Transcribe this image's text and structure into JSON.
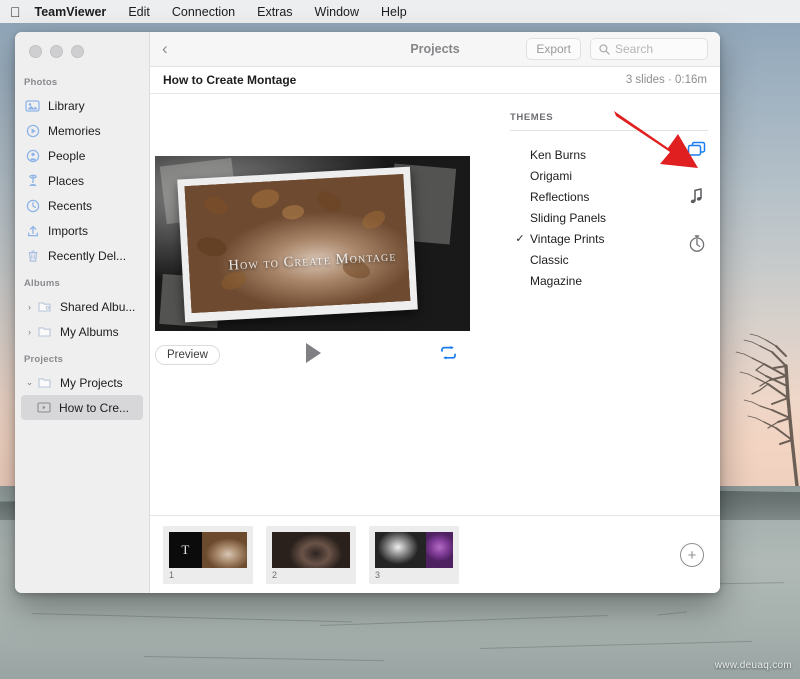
{
  "menubar": {
    "apple_icon": "apple-logo",
    "items": [
      {
        "label": "TeamViewer",
        "bold": true
      },
      {
        "label": "Edit"
      },
      {
        "label": "Connection"
      },
      {
        "label": "Extras"
      },
      {
        "label": "Window"
      },
      {
        "label": "Help"
      }
    ]
  },
  "window": {
    "toolbar": {
      "back_icon": "chevron-left-icon",
      "title": "Projects",
      "export_label": "Export",
      "search_icon": "search-icon",
      "search_placeholder": "Search",
      "search_value": ""
    },
    "subbar": {
      "project_title": "How to Create Montage",
      "meta": "3 slides · 0:16m"
    }
  },
  "sidebar": {
    "sections": [
      {
        "header": "Photos",
        "items": [
          {
            "label": "Library",
            "icon": "photos-library-icon"
          },
          {
            "label": "Memories",
            "icon": "memories-icon"
          },
          {
            "label": "People",
            "icon": "people-icon"
          },
          {
            "label": "Places",
            "icon": "places-pin-icon"
          },
          {
            "label": "Recents",
            "icon": "clock-icon"
          },
          {
            "label": "Imports",
            "icon": "import-tray-icon"
          },
          {
            "label": "Recently Del...",
            "icon": "trash-icon"
          }
        ]
      },
      {
        "header": "Albums",
        "items": [
          {
            "label": "Shared Albu...",
            "icon": "shared-album-icon",
            "twisty": "›"
          },
          {
            "label": "My Albums",
            "icon": "folder-icon",
            "twisty": "›"
          }
        ]
      },
      {
        "header": "Projects",
        "items": [
          {
            "label": "My Projects",
            "icon": "folder-icon",
            "twisty": "⌄"
          },
          {
            "label": "How to Cre...",
            "icon": "project-slideshow-icon",
            "selected": true
          }
        ]
      }
    ]
  },
  "stage": {
    "preview_overlay_title": "How to Create Montage",
    "preview_button_label": "Preview",
    "play_icon": "play-triangle-icon",
    "loop_icon": "loop-repeat-icon"
  },
  "themes_panel": {
    "header": "THEMES",
    "selected": "Vintage Prints",
    "check_glyph": "✓",
    "items": [
      {
        "label": "Ken Burns",
        "checked": false
      },
      {
        "label": "Origami",
        "checked": false
      },
      {
        "label": "Reflections",
        "checked": false
      },
      {
        "label": "Sliding Panels",
        "checked": false
      },
      {
        "label": "Vintage Prints",
        "checked": true
      },
      {
        "label": "Classic",
        "checked": false
      },
      {
        "label": "Magazine",
        "checked": false
      }
    ],
    "rail": [
      {
        "name": "themes-icon",
        "active": true
      },
      {
        "name": "music-note-icon",
        "active": false
      },
      {
        "name": "duration-stopwatch-icon",
        "active": false
      }
    ],
    "annotation": {
      "type": "red-arrow",
      "points_to": "themes-icon",
      "color": "#e02020"
    }
  },
  "slides_strip": {
    "slides": [
      {
        "number": "1",
        "kind": "title-card-and-photo",
        "title_glyph": "T"
      },
      {
        "number": "2",
        "kind": "photo"
      },
      {
        "number": "3",
        "kind": "photo"
      }
    ],
    "add_button": {
      "icon": "plus-circle-icon",
      "glyph": "+"
    }
  },
  "desktop": {
    "watermark": "www.deuaq.com"
  },
  "colors": {
    "accent_blue": "#1a7ef2",
    "annotation_red": "#e02020",
    "sidebar_bg": "#efeff0",
    "selection_gray": "#d7d7d9"
  }
}
